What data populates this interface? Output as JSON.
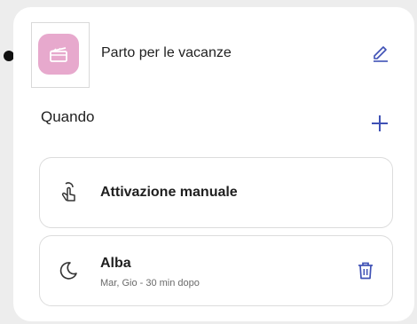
{
  "header": {
    "title": "Parto per le vacanze",
    "icon": "clapperboard-icon",
    "accent_color": "#e7a9cd",
    "edit_icon": "pencil-icon"
  },
  "section": {
    "label": "Quando",
    "add_icon": "plus-icon"
  },
  "triggers": [
    {
      "title": "Attivazione manuale",
      "icon": "tap-hand-icon"
    },
    {
      "title": "Alba",
      "subtitle": "Mar, Gio - 30 min dopo",
      "icon": "moon-icon",
      "delete_icon": "trash-icon"
    }
  ],
  "colors": {
    "primary": "#3f51b5",
    "text": "#1f1f1f"
  }
}
